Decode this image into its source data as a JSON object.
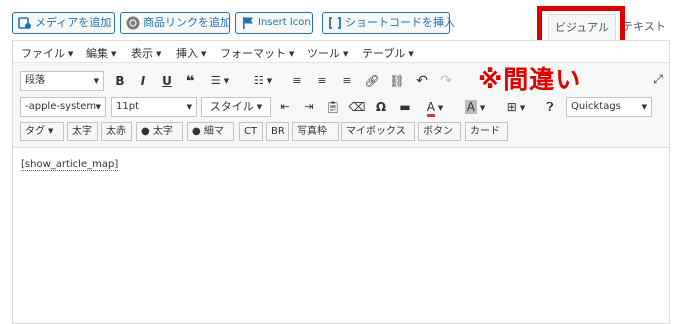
{
  "media_buttons": {
    "add_media": "メディアを追加",
    "add_product_link": "商品リンクを追加",
    "insert_icon": "Insert Icon",
    "insert_shortcode": "ショートコードを挿入"
  },
  "tabs": {
    "visual": "ビジュアル",
    "text": "テキスト"
  },
  "annotation": {
    "warning": "※間違い",
    "highlight_color": "#e00000"
  },
  "menubar": {
    "file": "ファイル",
    "edit": "編集",
    "view": "表示",
    "insert": "挿入",
    "format": "フォーマット",
    "tools": "ツール",
    "table": "テーブル"
  },
  "toolbar1": {
    "block_format": "段落"
  },
  "toolbar2": {
    "font_family": "-apple-system",
    "font_size": "11pt",
    "styles": "スタイル",
    "quicktags": "Quicktags"
  },
  "quicktags": {
    "tag": "タグ",
    "bold": "太字",
    "red_bold": "太赤",
    "person_bold": "太字",
    "person_thin": "細マ",
    "ct": "CT",
    "br": "BR",
    "photo_frame": "写真枠",
    "my_box": "マイボックス",
    "button": "ボタン",
    "card": "カード"
  },
  "content": {
    "text": "[show_article_map]"
  }
}
